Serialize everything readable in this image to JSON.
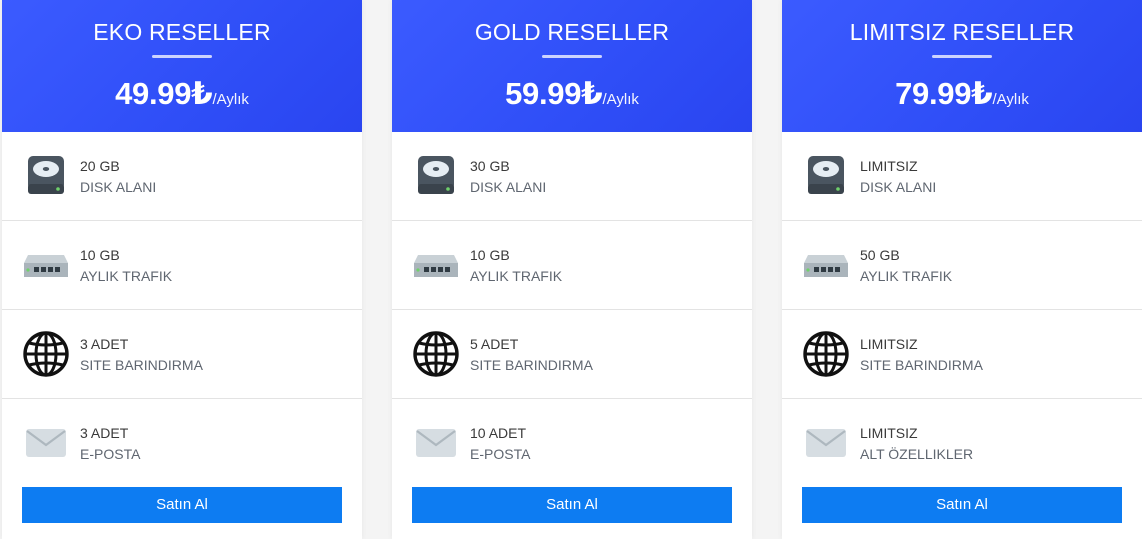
{
  "plans": [
    {
      "title": "EKO RESELLER",
      "price": "49.99₺",
      "period": "/Aylık",
      "features": [
        {
          "icon": "hard-drive-icon",
          "value": "20 GB",
          "label": "DISK ALANI"
        },
        {
          "icon": "network-switch-icon",
          "value": "10 GB",
          "label": "AYLIK TRAFIK"
        },
        {
          "icon": "globe-icon",
          "value": "3 ADET",
          "label": "SITE BARINDIRMA"
        },
        {
          "icon": "envelope-icon",
          "value": "3 ADET",
          "label": "E-POSTA"
        }
      ],
      "button_label": "Satın Al"
    },
    {
      "title": "GOLD RESELLER",
      "price": "59.99₺",
      "period": "/Aylık",
      "features": [
        {
          "icon": "hard-drive-icon",
          "value": "30 GB",
          "label": "DISK ALANI"
        },
        {
          "icon": "network-switch-icon",
          "value": "10 GB",
          "label": "AYLIK TRAFIK"
        },
        {
          "icon": "globe-icon",
          "value": "5 ADET",
          "label": "SITE BARINDIRMA"
        },
        {
          "icon": "envelope-icon",
          "value": "10 ADET",
          "label": "E-POSTA"
        }
      ],
      "button_label": "Satın Al"
    },
    {
      "title": "LIMITSIZ RESELLER",
      "price": "79.99₺",
      "period": "/Aylık",
      "features": [
        {
          "icon": "hard-drive-icon",
          "value": "LIMITSIZ",
          "label": "DISK ALANI"
        },
        {
          "icon": "network-switch-icon",
          "value": "50 GB",
          "label": "AYLIK TRAFIK"
        },
        {
          "icon": "globe-icon",
          "value": "LIMITSIZ",
          "label": "SITE BARINDIRMA"
        },
        {
          "icon": "envelope-icon",
          "value": "LIMITSIZ",
          "label": "ALT ÖZELLIKLER"
        }
      ],
      "button_label": "Satın Al"
    }
  ],
  "colors": {
    "header_gradient_start": "#3b5bff",
    "header_gradient_end": "#2a45f0",
    "button": "#0d7cf2"
  }
}
